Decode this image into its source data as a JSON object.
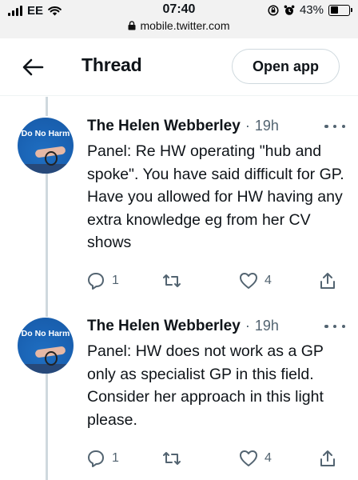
{
  "status_bar": {
    "carrier": "EE",
    "time": "07:40",
    "battery": "43%",
    "battery_level": 0.43,
    "url": "mobile.twitter.com"
  },
  "header": {
    "title": "Thread",
    "open_app_label": "Open app"
  },
  "tweets": [
    {
      "avatar_text": "Do No Harm",
      "author": "The Helen Webberley",
      "separator": "·",
      "time": "19h",
      "text": "Panel: Re HW operating \"hub and spoke\". You have said difficult for GP. Have you allowed for HW having any extra knowledge eg from her CV shows",
      "replies": "1",
      "likes": "4"
    },
    {
      "avatar_text": "Do No Harm",
      "author": "The Helen Webberley",
      "separator": "·",
      "time": "19h",
      "text": "Panel: HW does not work as a GP only as specialist GP in this field. Consider her approach in this light please.",
      "replies": "1",
      "likes": "4"
    }
  ],
  "icons": {
    "back": "arrow-left-icon",
    "reply": "reply-icon",
    "retweet": "retweet-icon",
    "like": "heart-icon",
    "share": "share-icon",
    "more": "more-icon"
  },
  "colors": {
    "text": "#0f1419",
    "muted": "#536471",
    "thread_line": "#cfd9de",
    "avatar_bg": "#1a62b3"
  }
}
